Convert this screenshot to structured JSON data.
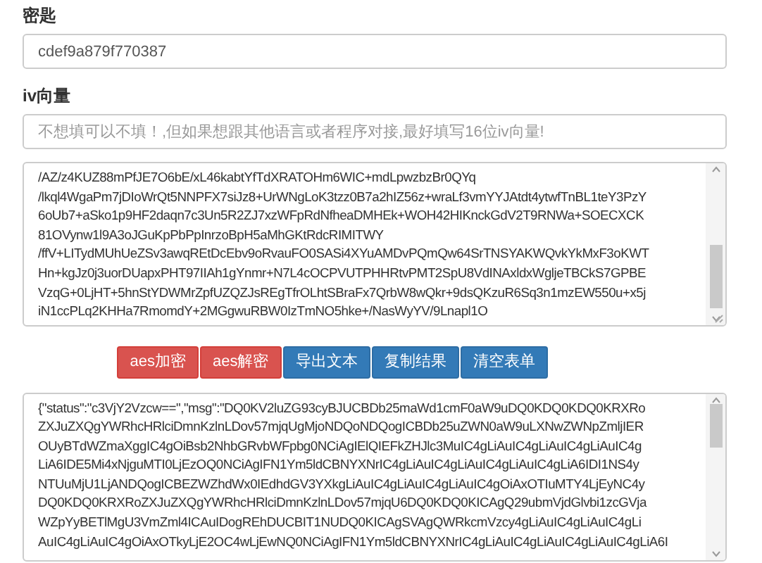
{
  "key_field": {
    "label": "密匙",
    "value": "cdef9a879f770387"
  },
  "iv_field": {
    "label": "iv向量",
    "placeholder": "不想填可以不填！,但如果想跟其他语言或者程序对接,最好填写16位iv向量!"
  },
  "input_text": {
    "lines": [
      "/AZ/z4KUZ88mPfJE7O6bE/xL46kabtYfTdXRATOHm6WIC+mdLpwzbzBr0QYq",
      "/lkql4WgaPm7jDIoWrQt5NNPFX7siJz8+UrWNgLoK3tzz0B7a2hIZ56z+wraLf3vmYYJAtdt4ytwfTnBL1teY3PzY",
      "6oUb7+aSko1p9HF2daqn7c3Un5R2ZJ7xzWFpRdNfheaDMHEk+WOH42HIKnckGdV2T9RNWa+SOECXCK",
      "81OVynw1l9A3oJGuKpPbPpInrzoBpH5aMhGKtRdcRIMITWY",
      "/ffV+LITydMUhUeZSv3awqREtDcEbv9oRvauFO0SASi4XYuAMDvPQmQw64SrTNSYAKWQvkYkMxF3oKWT",
      "Hn+kgJz0j3uorDUapxPHT97IIAh1gYnmr+N7L4cOCPVUTPHHRtvPMT2SpU8VdINAxldxWgljeTBCkS7GPBE",
      "VzqG+0LjHT+5hnStYDWMrZpfUZQZJsREgTfrOLhtSBraFx7QrbW8wQkr+9dsQKzuR6Sq3n1mzEW550u+x5j",
      "iN1ccPLq2KHHa7RmomdY+2MGgwuRBW0IzTmNO5hke+/NasWyYV/9Lnapl1O"
    ]
  },
  "buttons": [
    {
      "label": "aes加密",
      "kind": "danger"
    },
    {
      "label": "aes解密",
      "kind": "danger"
    },
    {
      "label": "导出文本",
      "kind": "primary"
    },
    {
      "label": "复制结果",
      "kind": "primary"
    },
    {
      "label": "清空表单",
      "kind": "primary"
    }
  ],
  "output_text": {
    "lines": [
      "{\"status\":\"c3VjY2Vzcw==\",\"msg\":\"DQ0KV2luZG93cyBJUCBDb25maWd1cmF0aW9uDQ0KDQ0KDQ0KRXRo",
      "ZXJuZXQgYWRhcHRlciDmnKzlnLDov57mjqUgMjoNDQoNDQogICBDb25uZWN0aW9uLXNwZWNpZmljIER",
      "OUyBTdWZmaXggIC4gOiBsb2NhbGRvbWFpbg0NCiAgIElQIEFkZHJlc3MuIC4gLiAuIC4gLiAuIC4gLiAuIC4g",
      "LiA6IDE5Mi4xNjguMTI0LjEzOQ0NCiAgIFN1Ym5ldCBNYXNrIC4gLiAuIC4gLiAuIC4gLiAuIC4gLiA6IDI1NS4y",
      "NTUuMjU1LjANDQogICBEZWZhdWx0IEdhdGV3YXkgLiAuIC4gLiAuIC4gLiAuIC4gOiAxOTIuMTY4LjEyNC4y",
      "DQ0KDQ0KRXRoZXJuZXQgYWRhcHRlciDmnKzlnLDov57mjqU6DQ0KDQ0KICAgQ29ubmVjdGlvbi1zcGVja",
      "WZpYyBETlMgU3VmZml4ICAuIDogREhDUCBIT1NUDQ0KICAgSVAgQWRkcmVzcy4gLiAuIC4gLiAuIC4gLi",
      "AuIC4gLiAuIC4gOiAxOTkyLjE2OC4wLjEwNQ0NCiAgIFN1Ym5ldCBNYXNrIC4gLiAuIC4gLiAuIC4gLiAuIC4gLiA6I"
    ]
  }
}
